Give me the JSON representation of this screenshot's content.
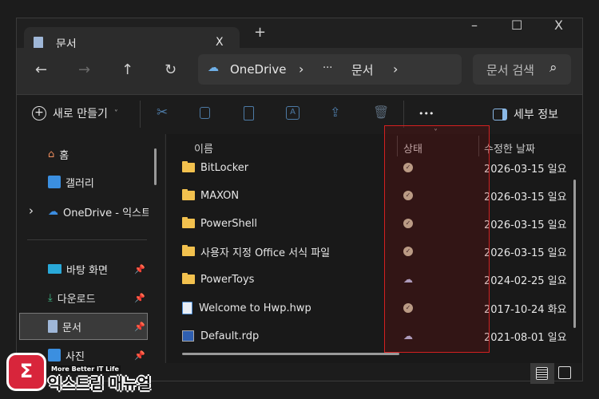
{
  "window": {
    "tab_title": "문서",
    "tab_close": "X",
    "new_tab": "+",
    "minimize": "–",
    "maximize": "☐",
    "close": "X"
  },
  "nav": {
    "back": "←",
    "forward": "→",
    "up": "↑",
    "refresh": "↻",
    "breadcrumb": [
      "OneDrive",
      "›",
      "···",
      "문서",
      "›"
    ],
    "search_placeholder": "문서 검색",
    "search_icon": "⌕"
  },
  "toolbar": {
    "new_label": "새로 만들기",
    "new_chevron": "˅",
    "more": "•••",
    "details_label": "세부 정보",
    "icons": [
      "cut-icon",
      "copy-icon",
      "paste-icon",
      "rename-icon",
      "share-icon",
      "delete-icon"
    ]
  },
  "sidebar": {
    "items": [
      {
        "label": "홈",
        "icon": "home-icon"
      },
      {
        "label": "갤러리",
        "icon": "gallery-icon"
      },
      {
        "label": "OneDrive - 익스트림",
        "icon": "cloud-icon",
        "expander": "›"
      },
      {
        "label": "바탕 화면",
        "icon": "desktop-icon",
        "pinned": true
      },
      {
        "label": "다운로드",
        "icon": "download-icon",
        "pinned": true
      },
      {
        "label": "문서",
        "icon": "document-icon",
        "pinned": true,
        "selected": true
      },
      {
        "label": "사진",
        "icon": "pictures-icon",
        "pinned": true
      }
    ]
  },
  "columns": {
    "name": "이름",
    "status": "상태",
    "modified": "수정한 날짜",
    "sort_indicator": "˅"
  },
  "files": [
    {
      "name": "BitLocker",
      "type": "folder",
      "status": "available",
      "modified": "2026-03-15 일요"
    },
    {
      "name": "MAXON",
      "type": "folder",
      "status": "available",
      "modified": "2026-03-15 일요"
    },
    {
      "name": "PowerShell",
      "type": "folder",
      "status": "available",
      "modified": "2026-03-15 일요"
    },
    {
      "name": "사용자 지정 Office 서식 파일",
      "type": "folder",
      "status": "available",
      "modified": "2026-03-15 일요"
    },
    {
      "name": "PowerToys",
      "type": "folder",
      "status": "cloud",
      "modified": "2024-02-25 일요"
    },
    {
      "name": "Welcome to Hwp.hwp",
      "type": "hwp",
      "status": "available",
      "modified": "2017-10-24 화요"
    },
    {
      "name": "Default.rdp",
      "type": "rdp",
      "status": "cloud",
      "modified": "2021-08-01 일요"
    }
  ],
  "watermark": {
    "tagline": "More Better IT Life",
    "brand": "익스트림 매뉴얼"
  },
  "highlight_color": "#d42020"
}
